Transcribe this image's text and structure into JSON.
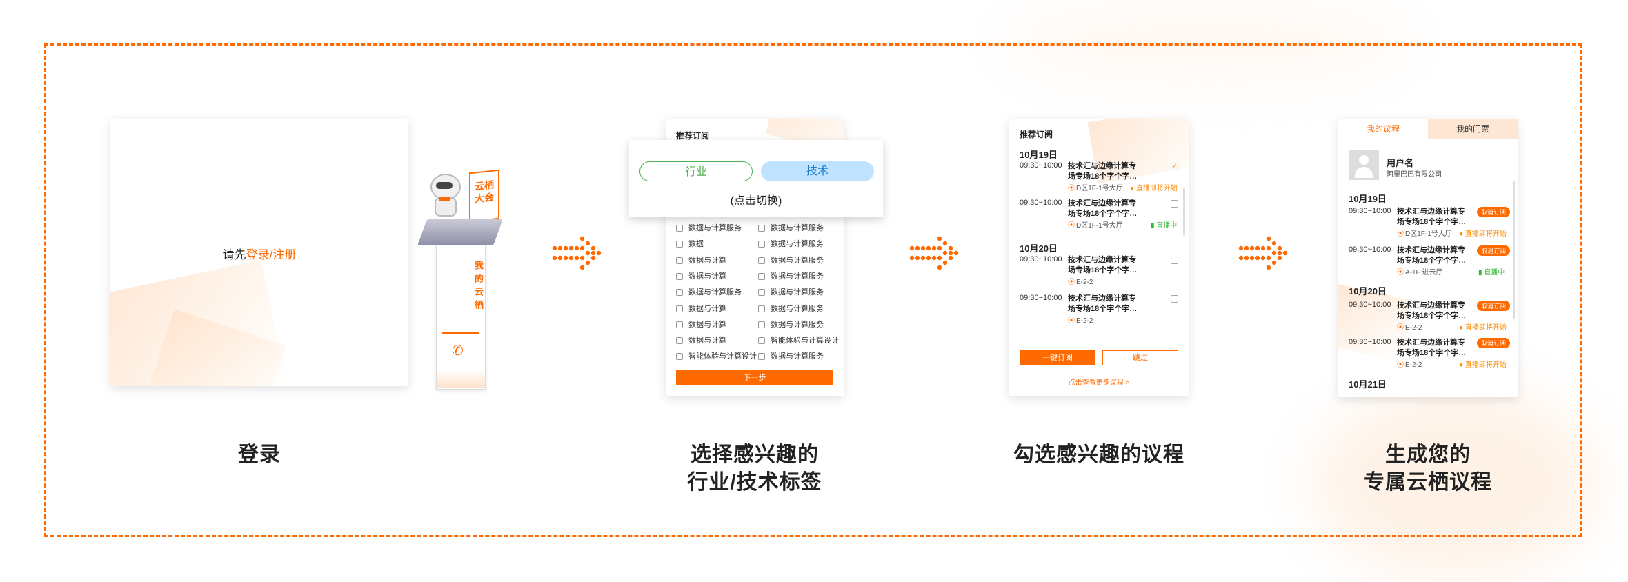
{
  "steps": [
    {
      "label_line1": "登录",
      "label_line2": ""
    },
    {
      "label_line1": "选择感兴趣的",
      "label_line2": "行业/技术标签"
    },
    {
      "label_line1": "勾选感兴趣的议程",
      "label_line2": ""
    },
    {
      "label_line1": "生成您的",
      "label_line2": "专属云栖议程"
    }
  ],
  "login": {
    "prompt": "请先",
    "link": "登录/注册"
  },
  "kiosk": {
    "sign_line1": "云栖",
    "sign_line2": "大会",
    "pillar_text": "我的云栖",
    "phone_icon": "phone-icon"
  },
  "select_tags": {
    "header": "推荐订阅",
    "toggle_industry": "行业",
    "toggle_tech": "技术",
    "toggle_hint": "(点击切换)",
    "left_items": [
      "数据与计算服务",
      "数据",
      "数据与计算",
      "数据与计算",
      "数据与计算服务",
      "数据与计算",
      "数据与计算",
      "数据与计算",
      "智能体验与计算设计"
    ],
    "right_items": [
      "数据与计算服务",
      "数据与计算服务",
      "数据与计算服务",
      "数据与计算服务",
      "数据与计算服务",
      "数据与计算服务",
      "数据与计算服务",
      "智能体验与计算设计",
      "数据与计算服务"
    ],
    "next_button": "下一步"
  },
  "pick_agenda": {
    "header": "推荐订阅",
    "date1": "10月19日",
    "date2": "10月20日",
    "items": [
      {
        "time": "09:30~10:00",
        "title": "技术汇与边缘计算专场专场18个字个字…",
        "loc": "D区1F-1号大厅",
        "status": "直播即将开始",
        "status_color": "#ff8a00",
        "checked": true
      },
      {
        "time": "09:30~10:00",
        "title": "技术汇与边缘计算专场专场18个字个字…",
        "loc": "D区1F-1号大厅",
        "status": "直播中",
        "status_color": "#2db82d",
        "checked": false
      },
      {
        "time": "09:30~10:00",
        "title": "技术汇与边缘计算专场专场18个字个字…",
        "loc": "E-2-2",
        "status": "",
        "status_color": "",
        "checked": false
      },
      {
        "time": "09:30~10:00",
        "title": "技术汇与边缘计算专场专场18个字个字…",
        "loc": "E-2-2",
        "status": "",
        "status_color": "",
        "checked": false
      }
    ],
    "subscribe_button": "一键订阅",
    "skip_button": "跳过",
    "more_link": "点击查看更多议程 >"
  },
  "my_agenda": {
    "tab_agenda": "我的议程",
    "tab_tickets": "我的门票",
    "username": "用户名",
    "company": "阿里巴巴有限公司",
    "date1": "10月19日",
    "date2": "10月20日",
    "date3": "10月21日",
    "cancel_label": "取消订阅",
    "items": [
      {
        "time": "09:30~10:00",
        "title": "技术汇与边缘计算专场专场18个字个字…",
        "loc": "D区1F-1号大厅",
        "status": "直播即将开始",
        "status_color": "#ff8a00"
      },
      {
        "time": "09:30~10:00",
        "title": "技术汇与边缘计算专场专场18个字个字…",
        "loc": "A-1F 进云厅",
        "status": "直播中",
        "status_color": "#2db82d"
      },
      {
        "time": "09:30~10:00",
        "title": "技术汇与边缘计算专场专场18个字个字…",
        "loc": "E-2-2",
        "status": "直播即将开始",
        "status_color": "#ff8a00"
      },
      {
        "time": "09:30~10:00",
        "title": "技术汇与边缘计算专场专场18个字个字…",
        "loc": "E-2-2",
        "status": "直播即将开始",
        "status_color": "#ff8a00"
      }
    ]
  },
  "colors": {
    "accent": "#ff6a00",
    "live": "#2db82d",
    "soon": "#ff8a00",
    "toggle_green": "#4caf50",
    "toggle_blue": "#bfe3ff"
  }
}
